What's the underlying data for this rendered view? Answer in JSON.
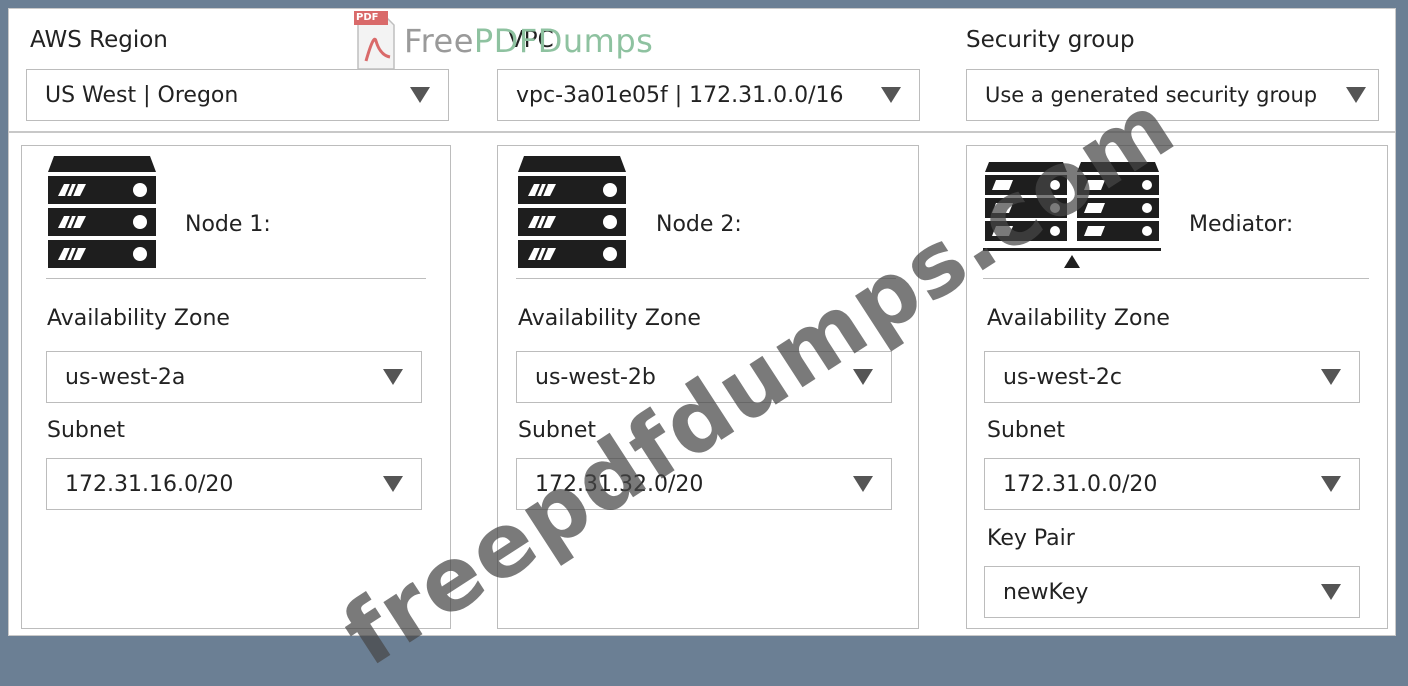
{
  "header": {
    "region": {
      "label": "AWS Region",
      "value": "US West | Oregon"
    },
    "vpc": {
      "label": "VPC",
      "value": "vpc-3a01e05f | 172.31.0.0/16"
    },
    "security_group": {
      "label": "Security group",
      "value": "Use a generated security group"
    }
  },
  "nodes": [
    {
      "title": "Node 1:",
      "az_label": "Availability Zone",
      "az_value": "us-west-2a",
      "subnet_label": "Subnet",
      "subnet_value": "172.31.16.0/20"
    },
    {
      "title": "Node 2:",
      "az_label": "Availability Zone",
      "az_value": "us-west-2b",
      "subnet_label": "Subnet",
      "subnet_value": "172.31.32.0/20"
    }
  ],
  "mediator": {
    "title": "Mediator:",
    "az_label": "Availability Zone",
    "az_value": "us-west-2c",
    "subnet_label": "Subnet",
    "subnet_value": "172.31.0.0/20",
    "keypair_label": "Key Pair",
    "keypair_value": "newKey"
  },
  "watermark": {
    "logo_badge": "PDF",
    "logo_text_gray": "Free",
    "logo_text_green": "PDFDumps",
    "diagonal": "freepdfdumps.com"
  },
  "icons": {
    "server": "server-stack-icon",
    "dropdown": "triangle-down-icon",
    "mediator": "mediator-servers-icon"
  },
  "colors": {
    "background": "#6b7f94",
    "panel": "#ffffff",
    "border": "#bcbcbc",
    "icon": "#1e1e1e"
  }
}
